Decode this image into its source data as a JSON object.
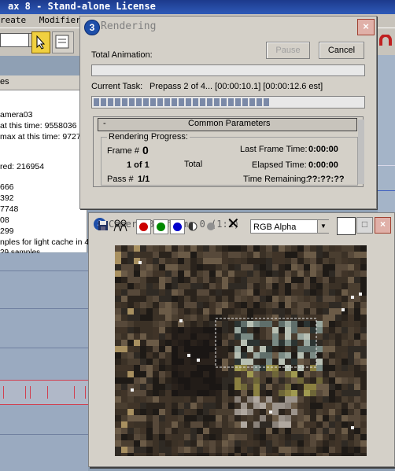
{
  "max_window": {
    "title": "ax 8  - Stand-alone License",
    "menu": [
      "reate",
      "Modifiers"
    ]
  },
  "log_panel": {
    "tab": "es",
    "lines": [
      "amera03",
      "at this time: 9558036",
      "max at this time: 9727",
      "red: 216954",
      "666",
      "392",
      "7748",
      "08",
      "299",
      "nples for light cache in 4",
      "29 samples."
    ]
  },
  "rendering_dialog": {
    "title": "Rendering",
    "close": "×",
    "total_animation_label": "Total Animation:",
    "pause_label": "Pause",
    "cancel_label": "Cancel",
    "current_task_label": "Current Task:",
    "current_task_value": "Prepass 2 of 4... [00:00:10.1] [00:00:12.6 est]",
    "current_task_progress": 0.65,
    "common_parameters": {
      "collapse": "-",
      "header": "Common Parameters",
      "group_title": "Rendering Progress:",
      "frame_label": "Frame #",
      "frame_value": "0",
      "frame_of": "1 of 1",
      "total_label": "Total",
      "pass_label": "Pass #",
      "pass_value": "1/1",
      "last_frame_time_label": "Last Frame Time:",
      "last_frame_time_value": "0:00:00",
      "elapsed_time_label": "Elapsed Time:",
      "elapsed_time_value": "0:00:00",
      "time_remaining_label": "Time Remaining:",
      "time_remaining_value": "??:??:??"
    }
  },
  "frame_window": {
    "title": "Camera03, frame 0 (1:1)",
    "minimize": "_",
    "maximize": "□",
    "close": "×",
    "channel_select": "RGB Alpha",
    "clear_symbol": "✕"
  },
  "colors": {
    "titlebar_blue": "#1c3a8c",
    "dialog_gray": "#d4d0c8",
    "progress_segment": "#7b8aa8",
    "red_channel": "#cc0000",
    "green_channel": "#008800",
    "blue_channel": "#0000cc"
  }
}
